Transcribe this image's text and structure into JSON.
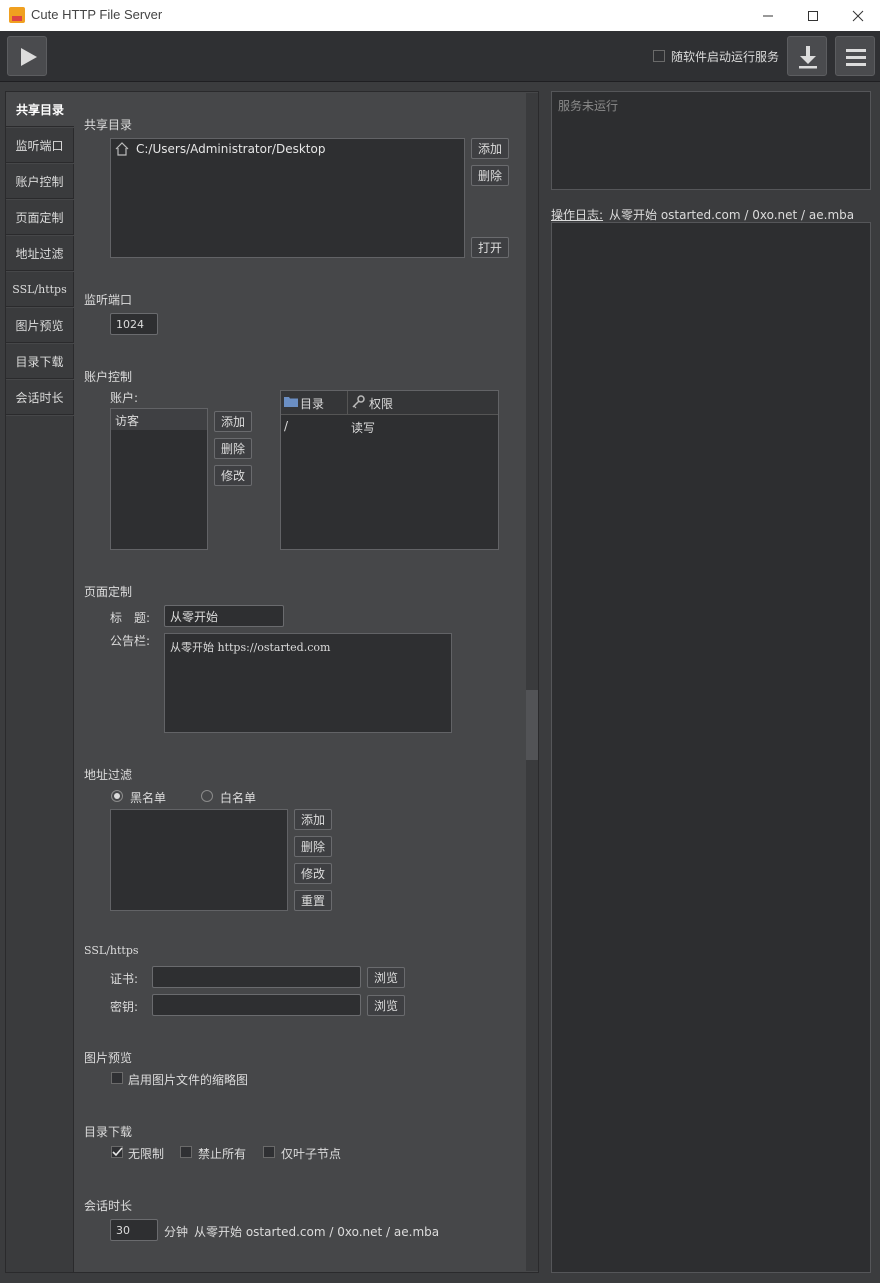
{
  "window": {
    "title": "Cute HTTP File Server"
  },
  "toolbar": {
    "autostart_label": "随软件启动运行服务"
  },
  "tabs": [
    "共享目录",
    "监听端口",
    "账户控制",
    "页面定制",
    "地址过滤",
    "SSL/https",
    "图片预览",
    "目录下载",
    "会话时长"
  ],
  "share": {
    "section": "共享目录",
    "path": "C:/Users/Administrator/Desktop",
    "add": "添加",
    "remove": "删除",
    "open": "打开"
  },
  "port": {
    "section": "监听端口",
    "value": "1024"
  },
  "account": {
    "section": "账户控制",
    "accounts_label": "账户:",
    "accounts": [
      "访客"
    ],
    "add": "添加",
    "remove": "删除",
    "edit": "修改",
    "table_headers": [
      "目录",
      "权限"
    ],
    "rows": [
      {
        "dir": "/",
        "perm": "读写"
      }
    ]
  },
  "page": {
    "section": "页面定制",
    "title_label": "标　题:",
    "title_value": "从零开始",
    "notice_label": "公告栏:",
    "notice_value": "从零开始 https://ostarted.com"
  },
  "filter": {
    "section": "地址过滤",
    "blacklist": "黑名单",
    "whitelist": "白名单",
    "add": "添加",
    "remove": "删除",
    "edit": "修改",
    "reset": "重置"
  },
  "ssl": {
    "section": "SSL/https",
    "cert_label": "证书:",
    "key_label": "密钥:",
    "browse": "浏览"
  },
  "preview": {
    "section": "图片预览",
    "thumb_label": "启用图片文件的缩略图"
  },
  "download": {
    "section": "目录下载",
    "unlimited": "无限制",
    "deny_all": "禁止所有",
    "leaf_only": "仅叶子节点"
  },
  "session": {
    "section": "会话时长",
    "value": "30",
    "unit": "分钟",
    "note": "从零开始 ostarted.com / 0xo.net / ae.mba"
  },
  "status": {
    "text": "服务未运行"
  },
  "log": {
    "label": "操作日志:",
    "note": "从零开始 ostarted.com / 0xo.net / ae.mba"
  }
}
